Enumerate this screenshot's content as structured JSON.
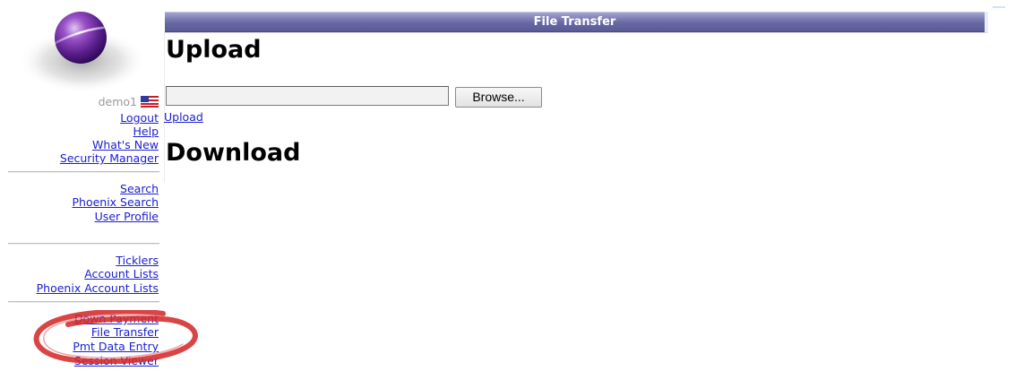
{
  "page": {
    "title_bar": "File Transfer"
  },
  "sidebar": {
    "username": "demo1",
    "flag_icon": "us-flag-icon",
    "logo_icon": "purple-orbit-sphere-logo",
    "group1": [
      "Logout",
      "Help",
      "What's New",
      "Security Manager"
    ],
    "group2": [
      "Search",
      "Phoenix Search",
      "User Profile"
    ],
    "group3": [
      "Ticklers",
      "Account Lists",
      "Phoenix Account Lists"
    ],
    "group4": [
      "Down Payment",
      "File Transfer",
      "Pmt Data Entry",
      "Session Viewer"
    ],
    "highlight_color": "#d42a2a"
  },
  "upload": {
    "heading": "Upload",
    "file_value": "",
    "browse_label": "Browse...",
    "upload_link": "Upload"
  },
  "download": {
    "heading": "Download"
  },
  "colors": {
    "link": "#1d20cf",
    "title_bar": "#6767a3",
    "username": "#9a9a9a"
  }
}
